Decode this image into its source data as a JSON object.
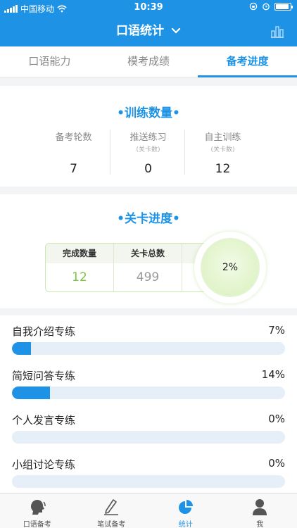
{
  "status_bar": {
    "carrier": "中国移动",
    "time": "10:39"
  },
  "header": {
    "title": "口语统计"
  },
  "tabs": [
    {
      "label": "口语能力",
      "active": false
    },
    {
      "label": "模考成绩",
      "active": false
    },
    {
      "label": "备考进度",
      "active": true
    }
  ],
  "training": {
    "title": "•训练数量•",
    "stats": [
      {
        "label": "备考轮数",
        "sub": "",
        "value": "7"
      },
      {
        "label": "推送练习",
        "sub": "(关卡数)",
        "value": "0"
      },
      {
        "label": "自主训练",
        "sub": "(关卡数)",
        "value": "12"
      }
    ]
  },
  "level_progress": {
    "title": "•关卡进度•",
    "completed_label": "完成数量",
    "completed_value": "12",
    "total_label": "关卡总数",
    "total_value": "499",
    "percent": "2%"
  },
  "drills": [
    {
      "name": "自我介绍专练",
      "percent": "7%",
      "fraction": 0.07
    },
    {
      "name": "简短问答专练",
      "percent": "14%",
      "fraction": 0.14
    },
    {
      "name": "个人发言专练",
      "percent": "0%",
      "fraction": 0
    },
    {
      "name": "小组讨论专练",
      "percent": "0%",
      "fraction": 0
    }
  ],
  "tabbar": [
    {
      "label": "口语备考",
      "icon": "speaking-icon",
      "active": false
    },
    {
      "label": "笔试备考",
      "icon": "pen-icon",
      "active": false
    },
    {
      "label": "统计",
      "icon": "pie-chart-icon",
      "active": true
    },
    {
      "label": "我",
      "icon": "person-icon",
      "active": false
    }
  ],
  "colors": {
    "primary": "#1e93e6",
    "completed_green": "#7cc43a",
    "total_gray": "#999999"
  }
}
